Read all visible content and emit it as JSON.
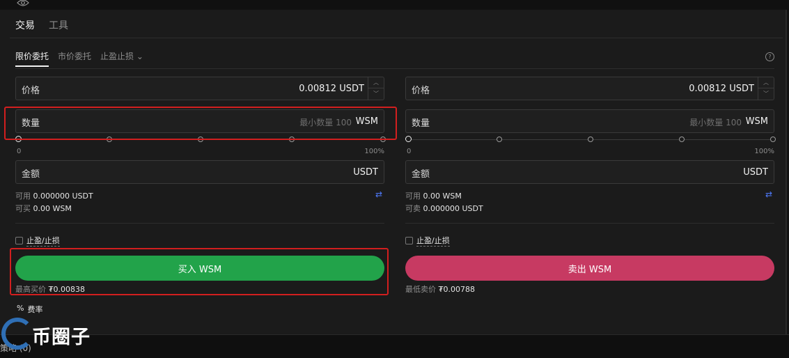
{
  "main_tabs": [
    {
      "label": "交易",
      "active": true
    },
    {
      "label": "工具",
      "active": false
    }
  ],
  "order_types": [
    {
      "label": "限价委托",
      "active": true
    },
    {
      "label": "市价委托",
      "active": false
    },
    {
      "label": "止盈止损",
      "active": false
    }
  ],
  "buy": {
    "price_label": "价格",
    "price_value": "0.00812",
    "price_unit": "USDT",
    "qty_label": "数量",
    "qty_placeholder": "最小数量 100",
    "qty_unit": "WSM",
    "slider_min": "0",
    "slider_max": "100%",
    "amount_label": "金额",
    "amount_unit": "USDT",
    "available_label": "可用",
    "available_value": "0.000000 USDT",
    "can_label": "可买",
    "can_value": "0.00 WSM",
    "tpsl_label": "止盈/止损",
    "button_label": "买入 WSM",
    "best_label": "最高买价",
    "best_value": "₮0.00838",
    "button_color": "#22a34a"
  },
  "sell": {
    "price_label": "价格",
    "price_value": "0.00812",
    "price_unit": "USDT",
    "qty_label": "数量",
    "qty_placeholder": "最小数量 100",
    "qty_unit": "WSM",
    "slider_min": "0",
    "slider_max": "100%",
    "amount_label": "金额",
    "amount_unit": "USDT",
    "available_label": "可用",
    "available_value": "0.00 WSM",
    "can_label": "可卖",
    "can_value": "0.000000 USDT",
    "tpsl_label": "止盈/止损",
    "button_label": "卖出 WSM",
    "best_label": "最低卖价",
    "best_value": "₮0.00788",
    "button_color": "#c73a62"
  },
  "fee": {
    "icon": "%",
    "label": "费率"
  },
  "watermark": "币圈子",
  "footer": {
    "strategy": "策略 (0)"
  }
}
